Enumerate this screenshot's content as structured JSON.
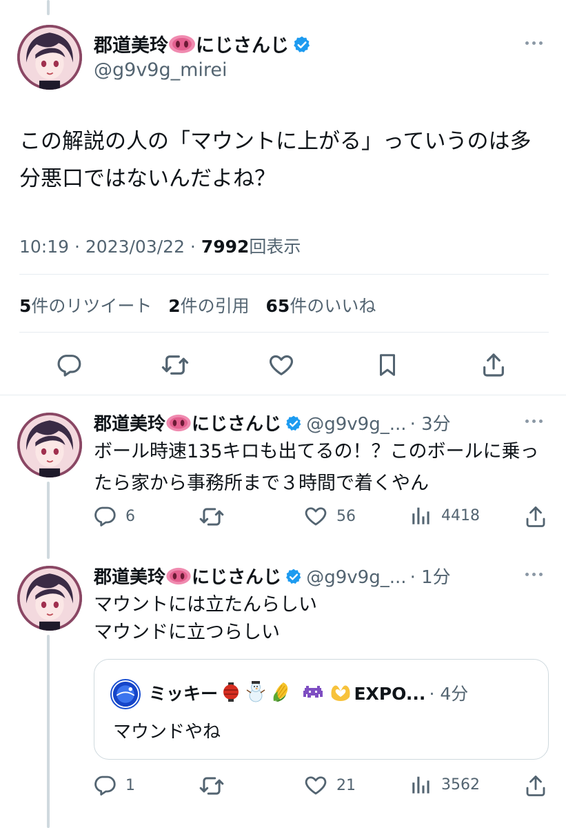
{
  "main_tweet": {
    "display_name": "郡道美玲",
    "name_suffix": "にじさんじ",
    "handle": "@g9v9g_mirei",
    "text": "この解説の人の「マウントに上がる」っていうのは多分悪口ではないんだよね？",
    "time": "10:19 · 2023/03/22 · ",
    "views_count": "7992",
    "views_label": "回表示",
    "retweets_count": "5",
    "retweets_label": "件のリツイート",
    "quotes_count": "2",
    "quotes_label": "件の引用",
    "likes_count": "65",
    "likes_label": "件のいいね"
  },
  "replies": [
    {
      "display_name": "郡道美玲",
      "name_suffix": "にじさんじ",
      "handle": "@g9v9g_...",
      "time": "· 3分",
      "text": "ボール時速135キロも出てるの！？このボールに乗ったら家から事務所まで３時間で着くやん",
      "reply_count": "6",
      "like_count": "56",
      "view_count": "4418"
    },
    {
      "display_name": "郡道美玲",
      "name_suffix": "にじさんじ",
      "handle": "@g9v9g_...",
      "time": "· 1分",
      "text_line1": "マウントには立たんらしい",
      "text_line2": "マウンドに立つらしい",
      "reply_count": "1",
      "like_count": "21",
      "view_count": "3562",
      "quote": {
        "display_name": "ミッキー",
        "name_tail": "EXPO...",
        "time": "· 4分",
        "text": "マウンドやね"
      }
    }
  ],
  "colors": {
    "text_primary": "#0f1419",
    "text_secondary": "#536471",
    "verified_blue": "#1d9bf0",
    "divider": "#e6ecf0",
    "thread_line": "#cfd9de"
  }
}
